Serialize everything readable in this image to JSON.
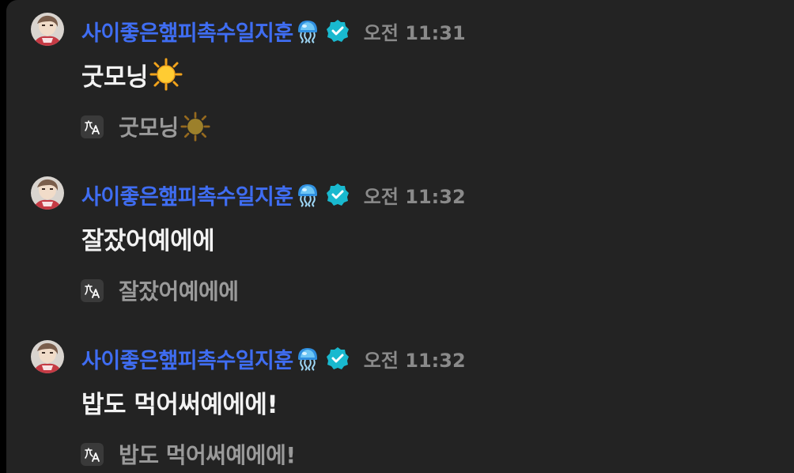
{
  "messages": [
    {
      "username": "사이좋은햎피촉수일지훈",
      "username_emoji": "jellyfish-icon",
      "badge": "verified-icon",
      "timestamp": "오전 11:31",
      "text": "굿모닝",
      "text_emoji": "sun-icon",
      "translation": "굿모닝",
      "translation_emoji": "sun-icon"
    },
    {
      "username": "사이좋은햎피촉수일지훈",
      "username_emoji": "jellyfish-icon",
      "badge": "verified-icon",
      "timestamp": "오전 11:32",
      "text": "잘잤어예에에",
      "text_emoji": "",
      "translation": "잘잤어예에에",
      "translation_emoji": ""
    },
    {
      "username": "사이좋은햎피촉수일지훈",
      "username_emoji": "jellyfish-icon",
      "badge": "verified-icon",
      "timestamp": "오전 11:32",
      "text": "밥도 먹어써예에에!",
      "text_emoji": "",
      "translation": "밥도 먹어써예에에!",
      "translation_emoji": ""
    }
  ],
  "colors": {
    "background": "#232323",
    "username": "#3f6df2",
    "verified": "#19b9cf",
    "timestamp": "#8a8a8a",
    "message_text": "#f2f2f2",
    "translation_text": "#9a9a9a"
  }
}
